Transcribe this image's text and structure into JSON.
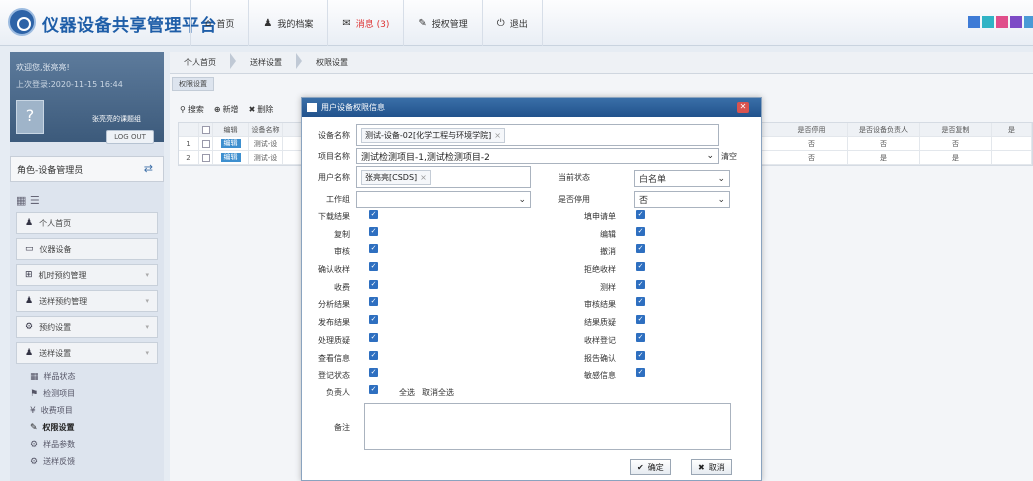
{
  "app": {
    "title": "仪器设备共享管理平台"
  },
  "nav": [
    {
      "icon": "home-icon",
      "glyph": "⌂",
      "label": "首页"
    },
    {
      "icon": "user-icon",
      "glyph": "♟",
      "label": "我的档案"
    },
    {
      "icon": "mail-icon",
      "glyph": "✉",
      "label": "消息 (3)"
    },
    {
      "icon": "auth-icon",
      "glyph": "✎",
      "label": "授权管理"
    },
    {
      "icon": "power-icon",
      "glyph": "⏻",
      "label": "退出"
    }
  ],
  "colors": {
    "blocks": [
      "#3e7bd6",
      "#30b3c5",
      "#e04e8b",
      "#7d4bc6",
      "#4a9ad6"
    ],
    "accent": "#2d63a7"
  },
  "sidebar": {
    "welcome": "欢迎您,张亮亮!",
    "last_login": "上次登录:2020-11-15 16:44",
    "group": "张亮亮的课题组",
    "logout": "LOG OUT",
    "role": "角色-设备管理员",
    "menu": [
      {
        "label": "个人首页",
        "glyph": "♟",
        "arrow": false
      },
      {
        "label": "仪器设备",
        "glyph": "▭",
        "arrow": false
      },
      {
        "label": "机时预约管理",
        "glyph": "⊞",
        "arrow": true
      },
      {
        "label": "送样预约管理",
        "glyph": "♟",
        "arrow": true
      },
      {
        "label": "预约设置",
        "glyph": "⚙",
        "arrow": true
      },
      {
        "label": "送样设置",
        "glyph": "♟",
        "arrow": true
      }
    ],
    "submenu": [
      {
        "label": "样品状态",
        "glyph": "▦"
      },
      {
        "label": "检测项目",
        "glyph": "⚑"
      },
      {
        "label": "收费项目",
        "glyph": "¥"
      },
      {
        "label": "权限设置",
        "glyph": "✎"
      },
      {
        "label": "样品参数",
        "glyph": "⚙"
      },
      {
        "label": "送样反馈",
        "glyph": "⚙"
      }
    ]
  },
  "breadcrumb": [
    "个人首页",
    "送样设置",
    "权限设置"
  ],
  "tab": "权限设置",
  "toolbar": {
    "search": "搜索",
    "add": "新增",
    "delete": "删除"
  },
  "grid": {
    "headers": [
      "编辑",
      "设备名称"
    ],
    "rows": [
      {
        "num": "1",
        "edit": "编辑",
        "name": "测试-设"
      },
      {
        "num": "2",
        "edit": "编辑",
        "name": "测试-设"
      }
    ],
    "right_headers": [
      "是否停用",
      "是否设备负责人",
      "是否复制",
      "是"
    ],
    "right_rows": [
      [
        "否",
        "否",
        "否",
        ""
      ],
      [
        "否",
        "是",
        "是",
        ""
      ]
    ]
  },
  "modal": {
    "title": "用户设备权限信息",
    "device_label": "设备名称",
    "device_value": "测试-设备-02[化学工程与环境学院]",
    "project_label": "项目名称",
    "project_value": "测试检测项目-1,测试检测项目-2",
    "clear": "清空",
    "user_label": "用户名称",
    "user_value": "张亮亮[CSDS]",
    "status_label": "当前状态",
    "status_value": "白名单",
    "group_label": "工作组",
    "group_value": "",
    "disabled_label": "是否停用",
    "disabled_value": "否",
    "perms_left": [
      "下载结果",
      "复制",
      "审核",
      "确认收样",
      "收费",
      "分析结果",
      "发布结果",
      "处理质疑",
      "查看信息",
      "登记状态",
      "负责人"
    ],
    "perms_right": [
      "填申请单",
      "编辑",
      "撤消",
      "拒绝收样",
      "测样",
      "审核结果",
      "结果质疑",
      "收样登记",
      "报告确认",
      "敏感信息"
    ],
    "select_all": "全选",
    "deselect_all": "取消全选",
    "note_label": "备注",
    "ok": "确定",
    "cancel": "取消"
  }
}
